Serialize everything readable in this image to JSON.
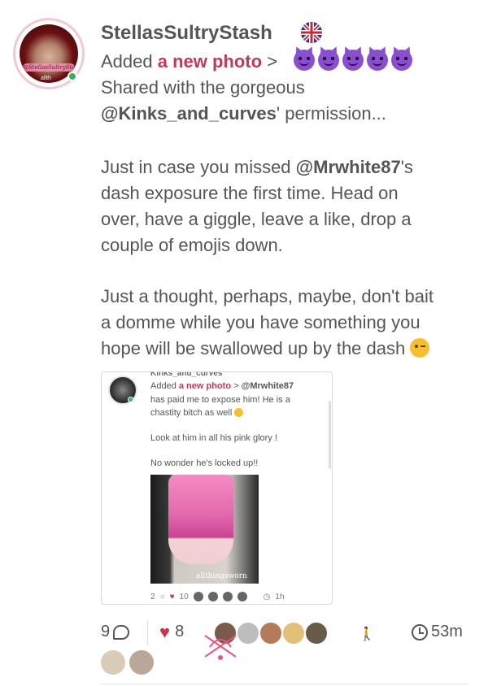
{
  "post": {
    "username": "StellasSultryStash",
    "avatar_watermark": "@StellasSultryStash",
    "avatar_tag": "allth",
    "flag_icon": "uk-flag-icon",
    "action_prefix": "Added",
    "action_link": "a new photo",
    "action_suffix": ">",
    "emoji_icons": [
      "smiling-devil-icon",
      "smiling-devil-icon",
      "smiling-devil-icon",
      "smiling-devil-icon",
      "smiling-devil-icon"
    ],
    "line1": "Shared with the gorgeous",
    "line2_mention": "@Kinks_and_curves",
    "line2_rest": "' permission...",
    "para2_line1_prefix": "Just in case you missed ",
    "para2_line1_mention": "@Mrwhite87",
    "para2_line1_rest": "'s",
    "para2_line2": "dash exposure the first time. Head on",
    "para2_line3": "over, have a giggle, leave a like, drop a",
    "para2_line4": "couple of emojis down.",
    "para3_line1": "Just a thought, perhaps, maybe, don't bait",
    "para3_line2": "a domme while you have something you",
    "para3_line3": "hope will be swallowed up by the dash",
    "wink_icon": "winking-face-icon"
  },
  "embedded": {
    "username": "Kinks_and_curves",
    "action_prefix": "Added",
    "action_link": "a new photo",
    "action_mid": ">",
    "mention": "@Mrwhite87",
    "line2": "has paid me to expose him! He is a",
    "line3": "chastity bitch as well",
    "line4": "Look at him in all his pink glory !",
    "line5": "No wonder he's locked up!!",
    "watermark": "allthingsworn",
    "comments": "2",
    "likes": "10",
    "time": "1h"
  },
  "footer": {
    "comments": "9",
    "likes": "8",
    "time": "53m",
    "liker_colors": [
      "#7a5a48",
      "#bdbdbd",
      "#b47a5a",
      "#e3c07a",
      "#6a5a4a"
    ],
    "accent": "#d2304f"
  }
}
